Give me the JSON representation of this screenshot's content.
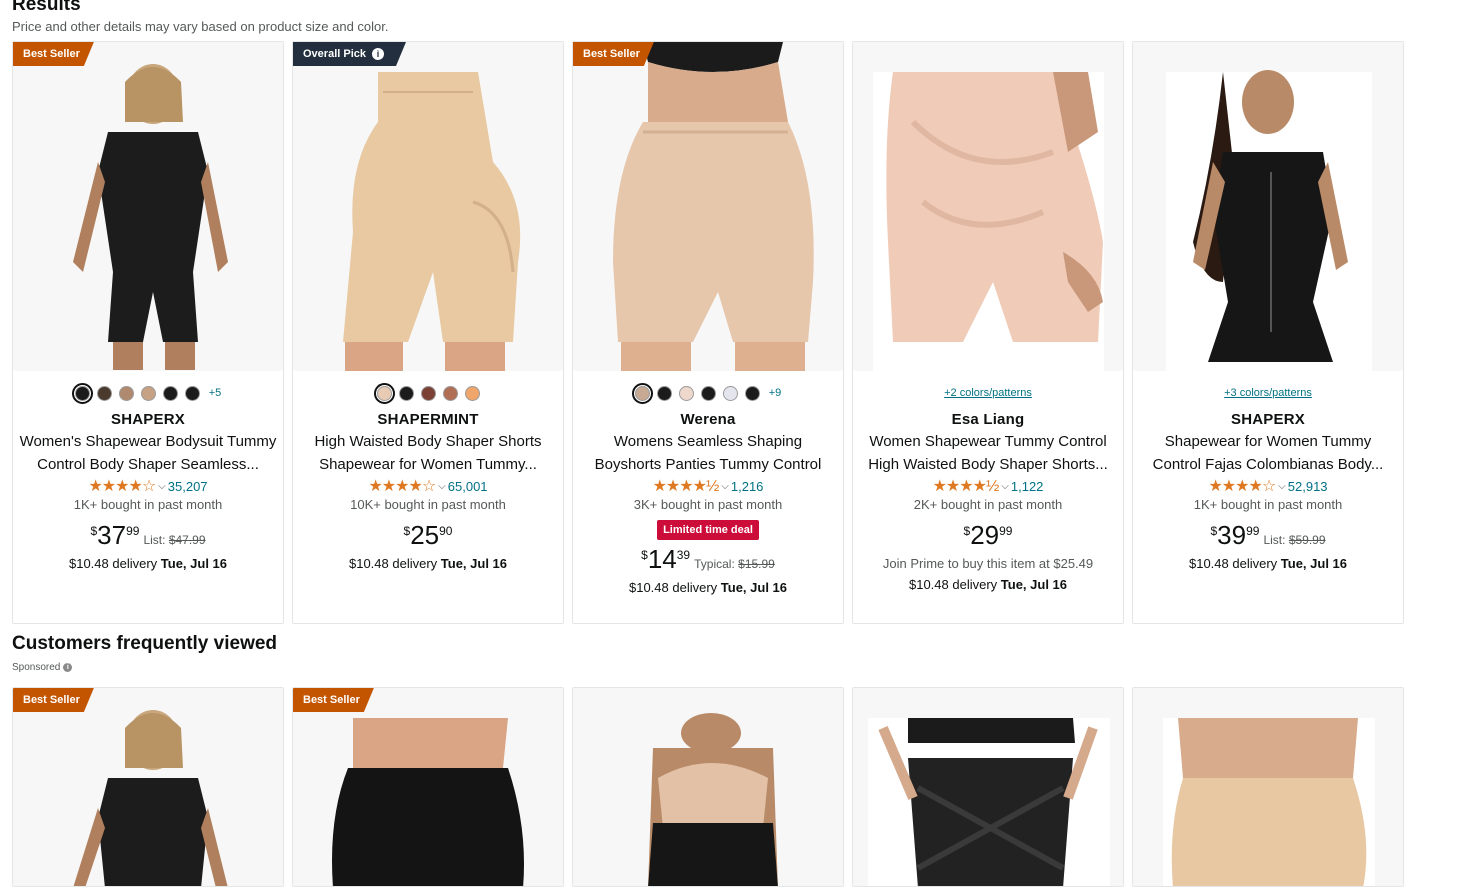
{
  "results": {
    "title": "Results",
    "subtitle": "Price and other details may vary based on product size and color."
  },
  "products": [
    {
      "badge": "Best Seller",
      "swatches": [
        "#1b1b1b",
        "#4a3a2e",
        "#b08a6e",
        "#c6a184",
        "#1b1b1b",
        "#1b1b1b"
      ],
      "more": "+5",
      "brand": "SHAPERX",
      "title": "Women's Shapewear Bodysuit Tummy Control Body Shaper Seamless...",
      "stars": "★★★★☆",
      "reviews": "35,207",
      "bought": "1K+ bought in past month",
      "price_symbol": "$",
      "price_whole": "37",
      "price_frac": "99",
      "list_label": "List:",
      "list_price": "$47.99",
      "delivery_prefix": "$10.48 delivery",
      "delivery_date": "Tue, Jul 16"
    },
    {
      "badge": "Overall Pick",
      "badge_icon": "i",
      "swatches": [
        "#e8cbb5",
        "#1b1b1b",
        "#7a4134",
        "#b06e55",
        "#f0a56a"
      ],
      "brand": "SHAPERMINT",
      "title": "High Waisted Body Shaper Shorts Shapewear for Women Tummy...",
      "stars": "★★★★☆",
      "reviews": "65,001",
      "bought": "10K+ bought in past month",
      "price_symbol": "$",
      "price_whole": "25",
      "price_frac": "90",
      "delivery_prefix": "$10.48 delivery",
      "delivery_date": "Tue, Jul 16"
    },
    {
      "badge": "Best Seller",
      "swatches": [
        "#c8aa94",
        "#1b1b1b",
        "#eed7cb",
        "#1b1b1b",
        "#e4e6ee",
        "#1b1b1b"
      ],
      "more": "+9",
      "brand": "Werena",
      "title": "Womens Seamless Shaping Boyshorts Panties Tummy Control Underwear...",
      "stars": "★★★★½",
      "reviews": "1,216",
      "bought": "3K+ bought in past month",
      "deal": "Limited time deal",
      "price_symbol": "$",
      "price_whole": "14",
      "price_frac": "39",
      "list_label": "Typical:",
      "list_price": "$15.99",
      "delivery_prefix": "$10.48 delivery",
      "delivery_date": "Tue, Jul 16"
    },
    {
      "colors_link": "+2 colors/patterns",
      "brand": "Esa Liang",
      "title": "Women Shapewear Tummy Control High Waisted Body Shaper Shorts...",
      "stars": "★★★★½",
      "reviews": "1,122",
      "bought": "2K+ bought in past month",
      "price_symbol": "$",
      "price_whole": "29",
      "price_frac": "99",
      "prime_note": "Join Prime to buy this item at $25.49",
      "delivery_prefix": "$10.48 delivery",
      "delivery_date": "Tue, Jul 16"
    },
    {
      "colors_link": "+3 colors/patterns",
      "brand": "SHAPERX",
      "title": "Shapewear for Women Tummy Control Fajas Colombianas Body...",
      "stars": "★★★★☆",
      "reviews": "52,913",
      "bought": "1K+ bought in past month",
      "price_symbol": "$",
      "price_whole": "39",
      "price_frac": "99",
      "list_label": "List:",
      "list_price": "$59.99",
      "delivery_prefix": "$10.48 delivery",
      "delivery_date": "Tue, Jul 16"
    }
  ],
  "cfv": {
    "title": "Customers frequently viewed",
    "sponsored": "Sponsored",
    "sponsored_icon": "i",
    "items": [
      {
        "badge": "Best Seller"
      },
      {
        "badge": "Best Seller"
      },
      {},
      {},
      {}
    ]
  }
}
